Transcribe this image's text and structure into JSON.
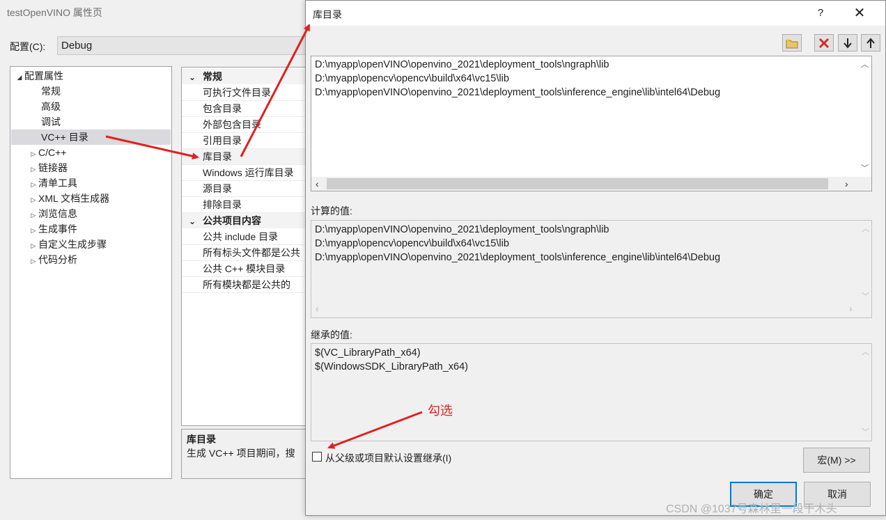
{
  "bg_window": {
    "title": "testOpenVINO 属性页",
    "config_label": "配置(C):",
    "config_value": "Debug"
  },
  "tree": {
    "root": "配置属性",
    "children": [
      "常规",
      "高级",
      "调试",
      "VC++ 目录"
    ],
    "collapsed": [
      "C/C++",
      "链接器",
      "清单工具",
      "XML 文档生成器",
      "浏览信息",
      "生成事件",
      "自定义生成步骤",
      "代码分析"
    ],
    "selected": "VC++ 目录"
  },
  "properties": {
    "category_1": "常规",
    "category_1_items": [
      "可执行文件目录",
      "包含目录",
      "外部包含目录",
      "引用目录",
      "库目录",
      "Windows 运行库目录",
      "源目录",
      "排除目录"
    ],
    "category_2": "公共项目内容",
    "category_2_items": [
      "公共 include 目录",
      "所有标头文件都是公共",
      "公共 C++ 模块目录",
      "所有模块都是公共的"
    ]
  },
  "description": {
    "title": "库目录",
    "text": "生成 VC++ 项目期间，搜"
  },
  "dialog": {
    "title": "库目录",
    "help": "?",
    "close": "✕",
    "edit_lines": [
      "D:\\myapp\\openVINO\\openvino_2021\\deployment_tools\\ngraph\\lib",
      "D:\\myapp\\opencv\\opencv\\build\\x64\\vc15\\lib",
      "D:\\myapp\\openVINO\\openvino_2021\\deployment_tools\\inference_engine\\lib\\intel64\\Debug"
    ],
    "computed_label": "计算的值:",
    "computed_lines": [
      "D:\\myapp\\openVINO\\openvino_2021\\deployment_tools\\ngraph\\lib",
      "D:\\myapp\\opencv\\opencv\\build\\x64\\vc15\\lib",
      "D:\\myapp\\openVINO\\openvino_2021\\deployment_tools\\inference_engine\\lib\\intel64\\Debug"
    ],
    "inherited_label": "继承的值:",
    "inherited_lines": [
      "$(VC_LibraryPath_x64)",
      "$(WindowsSDK_LibraryPath_x64)"
    ],
    "inherit_checkbox_label": "从父级或项目默认设置继承(I)",
    "inherit_checked": false,
    "macro_button": "宏(M) >>",
    "ok_button": "确定",
    "cancel_button": "取消"
  },
  "annotation": {
    "text": "勾选",
    "color": "#e02020"
  },
  "watermark": "CSDN @1037号森林里一段干木头"
}
